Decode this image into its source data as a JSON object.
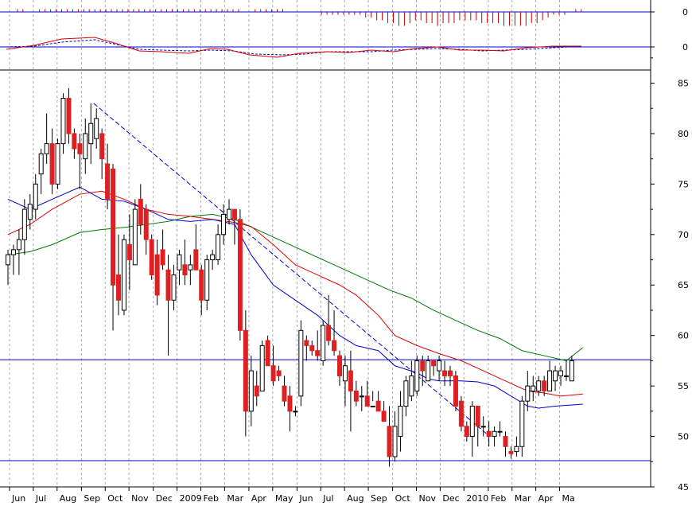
{
  "chart_data": {
    "type": "candlestick",
    "months_axis": [
      "Jun",
      "Jul",
      "Aug",
      "Sep",
      "Oct",
      "Nov",
      "Dec",
      "2009",
      "Feb",
      "Mar",
      "Apr",
      "May",
      "Jun",
      "Jul",
      "Aug",
      "Sep",
      "Oct",
      "Nov",
      "Dec",
      "2010",
      "Feb",
      "Mar",
      "Apr",
      "Ma"
    ],
    "month_positions_week": [
      0,
      4.3,
      8.6,
      13,
      17.3,
      21.6,
      26,
      30.3,
      34.6,
      38.9,
      43.3,
      47.6,
      52,
      56.3,
      60.6,
      64.9,
      69.3,
      73.6,
      77.9,
      82.2,
      86.6,
      90.9,
      95.2,
      99.5
    ],
    "price_ticks": [
      "45",
      "50",
      "55",
      "60",
      "65",
      "70",
      "75",
      "80",
      "85"
    ],
    "price_ylim": [
      45,
      86.3
    ],
    "panel2_tick": "0",
    "panel1_tick": "0",
    "horizontal_levels": [
      57.6,
      47.6
    ],
    "trendline": {
      "from": {
        "week": 15.5,
        "price": 83.0
      },
      "to": {
        "week": 86.5,
        "price": 50.3
      }
    },
    "colors": {
      "up_candle": "#ffffff",
      "down_candle": "#e02020",
      "sma_short": "#0000cc",
      "sma_mid": "#dd0000",
      "sma_long": "#007700",
      "level_line": "#0000cc",
      "osc_line": "#dd0000",
      "osc_signal": "#0000cc",
      "hist": "#cc0000"
    },
    "candles": [
      {
        "o": 67.0,
        "h": 68.5,
        "l": 65.0,
        "c": 68.0
      },
      {
        "o": 68.0,
        "h": 69.0,
        "l": 66.0,
        "c": 68.5
      },
      {
        "o": 68.5,
        "h": 70.5,
        "l": 66.0,
        "c": 69.5
      },
      {
        "o": 69.5,
        "h": 73.5,
        "l": 68.0,
        "c": 72.5
      },
      {
        "o": 71.5,
        "h": 74.0,
        "l": 70.5,
        "c": 73.0
      },
      {
        "o": 72.5,
        "h": 76.0,
        "l": 71.5,
        "c": 75.0
      },
      {
        "o": 76.0,
        "h": 78.5,
        "l": 74.0,
        "c": 78.0
      },
      {
        "o": 78.0,
        "h": 82.0,
        "l": 77.0,
        "c": 79.0
      },
      {
        "o": 79.0,
        "h": 80.5,
        "l": 74.0,
        "c": 75.0
      },
      {
        "o": 75.0,
        "h": 79.5,
        "l": 74.5,
        "c": 79.0
      },
      {
        "o": 79.0,
        "h": 84.0,
        "l": 78.0,
        "c": 83.5
      },
      {
        "o": 83.5,
        "h": 84.5,
        "l": 79.0,
        "c": 80.0
      },
      {
        "o": 80.0,
        "h": 80.5,
        "l": 77.5,
        "c": 78.5
      },
      {
        "o": 79.0,
        "h": 80.0,
        "l": 74.5,
        "c": 78.0
      },
      {
        "o": 77.5,
        "h": 81.5,
        "l": 76.0,
        "c": 80.0
      },
      {
        "o": 79.0,
        "h": 83.0,
        "l": 77.0,
        "c": 81.0
      },
      {
        "o": 79.5,
        "h": 82.5,
        "l": 78.5,
        "c": 81.5
      },
      {
        "o": 80.0,
        "h": 80.5,
        "l": 75.5,
        "c": 77.5
      },
      {
        "o": 77.0,
        "h": 79.0,
        "l": 72.5,
        "c": 73.5
      },
      {
        "o": 76.5,
        "h": 77.0,
        "l": 60.5,
        "c": 65.0
      },
      {
        "o": 66.0,
        "h": 70.0,
        "l": 62.0,
        "c": 63.5
      },
      {
        "o": 62.5,
        "h": 70.0,
        "l": 62.0,
        "c": 69.5
      },
      {
        "o": 69.0,
        "h": 72.0,
        "l": 64.5,
        "c": 67.5
      },
      {
        "o": 67.0,
        "h": 73.5,
        "l": 67.0,
        "c": 72.5
      },
      {
        "o": 73.5,
        "h": 75.0,
        "l": 70.0,
        "c": 71.0
      },
      {
        "o": 72.5,
        "h": 73.0,
        "l": 68.0,
        "c": 69.5
      },
      {
        "o": 69.5,
        "h": 70.0,
        "l": 65.5,
        "c": 66.0
      },
      {
        "o": 68.0,
        "h": 69.5,
        "l": 63.0,
        "c": 64.0
      },
      {
        "o": 68.5,
        "h": 70.5,
        "l": 66.5,
        "c": 67.0
      },
      {
        "o": 66.5,
        "h": 68.0,
        "l": 58.0,
        "c": 63.5
      },
      {
        "o": 63.5,
        "h": 67.0,
        "l": 62.5,
        "c": 66.0
      },
      {
        "o": 66.5,
        "h": 68.5,
        "l": 65.0,
        "c": 68.0
      },
      {
        "o": 67.0,
        "h": 69.5,
        "l": 65.0,
        "c": 66.0
      },
      {
        "o": 66.5,
        "h": 68.0,
        "l": 65.0,
        "c": 67.0
      },
      {
        "o": 68.5,
        "h": 71.0,
        "l": 66.5,
        "c": 66.5
      },
      {
        "o": 66.5,
        "h": 67.0,
        "l": 62.0,
        "c": 63.5
      },
      {
        "o": 63.5,
        "h": 68.0,
        "l": 62.5,
        "c": 67.5
      },
      {
        "o": 67.5,
        "h": 68.5,
        "l": 66.5,
        "c": 68.0
      },
      {
        "o": 67.5,
        "h": 71.0,
        "l": 67.0,
        "c": 70.0
      },
      {
        "o": 70.0,
        "h": 73.0,
        "l": 69.0,
        "c": 72.0
      },
      {
        "o": 71.5,
        "h": 73.5,
        "l": 71.0,
        "c": 72.5
      },
      {
        "o": 72.5,
        "h": 72.5,
        "l": 69.0,
        "c": 71.5
      },
      {
        "o": 71.5,
        "h": 72.5,
        "l": 59.5,
        "c": 60.5
      },
      {
        "o": 60.5,
        "h": 62.5,
        "l": 50.0,
        "c": 52.5
      },
      {
        "o": 52.5,
        "h": 58.0,
        "l": 51.0,
        "c": 56.5
      },
      {
        "o": 55.0,
        "h": 56.5,
        "l": 53.0,
        "c": 54.0
      },
      {
        "o": 54.5,
        "h": 59.5,
        "l": 54.5,
        "c": 59.0
      },
      {
        "o": 59.5,
        "h": 60.0,
        "l": 57.0,
        "c": 57.0
      },
      {
        "o": 57.0,
        "h": 59.0,
        "l": 55.0,
        "c": 55.5
      },
      {
        "o": 56.5,
        "h": 57.0,
        "l": 55.5,
        "c": 56.0
      },
      {
        "o": 55.0,
        "h": 56.0,
        "l": 53.0,
        "c": 53.5
      },
      {
        "o": 54.0,
        "h": 55.0,
        "l": 50.5,
        "c": 52.5
      },
      {
        "o": 52.5,
        "h": 53.0,
        "l": 52.0,
        "c": 52.5
      },
      {
        "o": 54.0,
        "h": 61.5,
        "l": 53.0,
        "c": 60.5
      },
      {
        "o": 59.5,
        "h": 60.0,
        "l": 57.5,
        "c": 59.0
      },
      {
        "o": 59.0,
        "h": 59.5,
        "l": 58.0,
        "c": 58.5
      },
      {
        "o": 58.5,
        "h": 60.5,
        "l": 57.5,
        "c": 58.0
      },
      {
        "o": 57.5,
        "h": 61.5,
        "l": 57.0,
        "c": 61.0
      },
      {
        "o": 61.0,
        "h": 64.0,
        "l": 59.0,
        "c": 59.5
      },
      {
        "o": 59.5,
        "h": 62.5,
        "l": 58.0,
        "c": 58.5
      },
      {
        "o": 58.0,
        "h": 58.5,
        "l": 55.0,
        "c": 56.0
      },
      {
        "o": 55.5,
        "h": 58.0,
        "l": 53.0,
        "c": 57.0
      },
      {
        "o": 56.5,
        "h": 58.5,
        "l": 50.5,
        "c": 54.5
      },
      {
        "o": 54.5,
        "h": 55.5,
        "l": 53.0,
        "c": 53.5
      },
      {
        "o": 54.0,
        "h": 55.0,
        "l": 52.5,
        "c": 54.0
      },
      {
        "o": 54.0,
        "h": 55.5,
        "l": 53.0,
        "c": 53.0
      },
      {
        "o": 53.0,
        "h": 54.5,
        "l": 53.5,
        "c": 53.0
      },
      {
        "o": 53.5,
        "h": 54.5,
        "l": 52.5,
        "c": 52.5
      },
      {
        "o": 52.5,
        "h": 53.5,
        "l": 51.5,
        "c": 51.5
      },
      {
        "o": 51.0,
        "h": 53.0,
        "l": 47.0,
        "c": 48.0
      },
      {
        "o": 48.0,
        "h": 52.5,
        "l": 47.5,
        "c": 51.0
      },
      {
        "o": 50.0,
        "h": 54.5,
        "l": 48.5,
        "c": 53.0
      },
      {
        "o": 53.0,
        "h": 56.0,
        "l": 52.0,
        "c": 55.5
      },
      {
        "o": 54.0,
        "h": 57.5,
        "l": 53.5,
        "c": 56.0
      },
      {
        "o": 54.5,
        "h": 58.0,
        "l": 54.0,
        "c": 57.5
      },
      {
        "o": 57.5,
        "h": 58.0,
        "l": 55.0,
        "c": 56.5
      },
      {
        "o": 55.5,
        "h": 58.0,
        "l": 55.5,
        "c": 57.5
      },
      {
        "o": 57.5,
        "h": 57.5,
        "l": 56.0,
        "c": 57.0
      },
      {
        "o": 56.5,
        "h": 58.0,
        "l": 55.5,
        "c": 57.5
      },
      {
        "o": 56.5,
        "h": 57.5,
        "l": 55.0,
        "c": 56.0
      },
      {
        "o": 56.5,
        "h": 57.0,
        "l": 55.0,
        "c": 56.0
      },
      {
        "o": 56.0,
        "h": 56.5,
        "l": 52.5,
        "c": 53.0
      },
      {
        "o": 53.5,
        "h": 54.0,
        "l": 50.5,
        "c": 51.0
      },
      {
        "o": 51.0,
        "h": 51.5,
        "l": 49.5,
        "c": 50.0
      },
      {
        "o": 50.0,
        "h": 53.5,
        "l": 48.0,
        "c": 53.0
      },
      {
        "o": 53.0,
        "h": 53.0,
        "l": 49.0,
        "c": 51.0
      },
      {
        "o": 51.0,
        "h": 52.0,
        "l": 50.0,
        "c": 51.0
      },
      {
        "o": 50.5,
        "h": 51.5,
        "l": 49.0,
        "c": 50.0
      },
      {
        "o": 50.0,
        "h": 51.0,
        "l": 49.0,
        "c": 50.5
      },
      {
        "o": 50.5,
        "h": 51.5,
        "l": 50.0,
        "c": 50.5
      },
      {
        "o": 50.0,
        "h": 50.5,
        "l": 48.0,
        "c": 49.0
      },
      {
        "o": 48.5,
        "h": 49.0,
        "l": 47.8,
        "c": 48.3
      },
      {
        "o": 48.5,
        "h": 50.0,
        "l": 48.0,
        "c": 49.0
      },
      {
        "o": 49.0,
        "h": 54.0,
        "l": 48.0,
        "c": 53.5
      },
      {
        "o": 53.5,
        "h": 56.5,
        "l": 52.5,
        "c": 55.0
      },
      {
        "o": 54.5,
        "h": 56.0,
        "l": 53.5,
        "c": 55.0
      },
      {
        "o": 54.5,
        "h": 56.0,
        "l": 54.0,
        "c": 55.5
      },
      {
        "o": 55.5,
        "h": 56.0,
        "l": 54.0,
        "c": 54.5
      },
      {
        "o": 54.5,
        "h": 57.5,
        "l": 54.5,
        "c": 56.5
      },
      {
        "o": 55.5,
        "h": 57.0,
        "l": 54.5,
        "c": 56.5
      },
      {
        "o": 56.0,
        "h": 57.0,
        "l": 55.0,
        "c": 56.5
      },
      {
        "o": 56.0,
        "h": 57.5,
        "l": 55.5,
        "c": 56.0
      },
      {
        "o": 55.5,
        "h": 58.0,
        "l": 55.5,
        "c": 57.5
      }
    ],
    "sma_short": [
      [
        0,
        73.5
      ],
      [
        4,
        72.5
      ],
      [
        8,
        73.5
      ],
      [
        13,
        74.7
      ],
      [
        17,
        73.5
      ],
      [
        21,
        73.3
      ],
      [
        25,
        72.5
      ],
      [
        29,
        71.5
      ],
      [
        33,
        71.3
      ],
      [
        37,
        71.5
      ],
      [
        41,
        71.0
      ],
      [
        44,
        68.0
      ],
      [
        48,
        65.0
      ],
      [
        52,
        63.5
      ],
      [
        56,
        62.0
      ],
      [
        60,
        60.0
      ],
      [
        63,
        59.0
      ],
      [
        67,
        58.5
      ],
      [
        70,
        57.0
      ],
      [
        74,
        56.3
      ],
      [
        76,
        55.7
      ],
      [
        78,
        55.5
      ],
      [
        82,
        55.5
      ],
      [
        85,
        55.4
      ],
      [
        88,
        55.0
      ],
      [
        91,
        54.0
      ],
      [
        94,
        53.0
      ],
      [
        96,
        52.8
      ],
      [
        99,
        53.0
      ],
      [
        104,
        53.2
      ]
    ],
    "sma_mid": [
      [
        0,
        70.0
      ],
      [
        4,
        71.0
      ],
      [
        8,
        72.5
      ],
      [
        13,
        74.0
      ],
      [
        17,
        74.3
      ],
      [
        21,
        73.5
      ],
      [
        25,
        72.5
      ],
      [
        29,
        72.0
      ],
      [
        33,
        71.8
      ],
      [
        37,
        71.5
      ],
      [
        41,
        71.2
      ],
      [
        44,
        70.8
      ],
      [
        48,
        69.0
      ],
      [
        52,
        67.0
      ],
      [
        56,
        66.0
      ],
      [
        60,
        65.0
      ],
      [
        63,
        64.0
      ],
      [
        67,
        62.0
      ],
      [
        70,
        60.0
      ],
      [
        74,
        59.0
      ],
      [
        78,
        58.2
      ],
      [
        82,
        57.5
      ],
      [
        86,
        56.5
      ],
      [
        90,
        55.5
      ],
      [
        94,
        54.5
      ],
      [
        97,
        54.3
      ],
      [
        100,
        54.0
      ],
      [
        104,
        54.2
      ]
    ],
    "sma_long": [
      [
        0,
        68.0
      ],
      [
        4,
        68.3
      ],
      [
        8,
        69.0
      ],
      [
        13,
        70.2
      ],
      [
        17,
        70.5
      ],
      [
        21,
        70.7
      ],
      [
        25,
        71.0
      ],
      [
        29,
        71.3
      ],
      [
        33,
        71.8
      ],
      [
        37,
        72.0
      ],
      [
        41,
        71.5
      ],
      [
        45,
        70.5
      ],
      [
        49,
        69.5
      ],
      [
        53,
        68.5
      ],
      [
        57,
        67.5
      ],
      [
        61,
        66.5
      ],
      [
        65,
        65.5
      ],
      [
        69,
        64.5
      ],
      [
        73,
        63.7
      ],
      [
        77,
        62.5
      ],
      [
        81,
        61.5
      ],
      [
        85,
        60.5
      ],
      [
        89,
        59.7
      ],
      [
        93,
        58.5
      ],
      [
        97,
        58.0
      ],
      [
        101,
        57.5
      ],
      [
        104,
        58.8
      ]
    ],
    "osc_panel_1": [
      0,
      0,
      -1,
      -1,
      0,
      0,
      -1,
      -1,
      -1,
      -1,
      -1,
      -1,
      -1,
      -1,
      -1,
      -1,
      -1,
      -1,
      -1,
      -1,
      -1,
      -1,
      -1,
      -1,
      -1,
      -1,
      -1,
      -1,
      -1,
      -1,
      -1,
      -1,
      -1,
      -1,
      -1,
      -1,
      -1,
      -1,
      -1,
      -1,
      -1,
      -1,
      -1,
      0,
      0,
      -1,
      -1,
      -1,
      -1,
      -1,
      -1,
      0,
      0,
      0,
      0,
      0,
      0,
      1,
      1,
      1,
      1,
      1,
      1,
      1,
      1,
      2,
      2,
      3,
      3,
      4,
      4,
      5,
      5,
      4,
      3,
      3,
      4,
      4,
      5,
      4,
      4,
      4,
      3,
      3,
      3,
      3,
      4,
      4,
      4,
      4,
      5,
      5,
      5,
      5,
      5,
      4,
      4,
      3,
      2,
      1,
      1,
      1,
      0,
      -1,
      -1
    ],
    "osc_panel_2_line": [
      [
        0,
        -0.3
      ],
      [
        5,
        0.2
      ],
      [
        10,
        1.0
      ],
      [
        16,
        1.2
      ],
      [
        20,
        0.4
      ],
      [
        24,
        -0.5
      ],
      [
        28,
        -0.6
      ],
      [
        33,
        -0.8
      ],
      [
        37,
        -0.2
      ],
      [
        40,
        -0.3
      ],
      [
        44,
        -1.0
      ],
      [
        49,
        -1.3
      ],
      [
        53,
        -0.8
      ],
      [
        58,
        -0.6
      ],
      [
        62,
        -0.7
      ],
      [
        66,
        -0.4
      ],
      [
        70,
        -0.6
      ],
      [
        74,
        -0.2
      ],
      [
        78,
        0.0
      ],
      [
        82,
        -0.4
      ],
      [
        86,
        -0.4
      ],
      [
        90,
        -0.5
      ],
      [
        94,
        -0.1
      ],
      [
        99,
        0.1
      ],
      [
        104,
        0.1
      ]
    ],
    "osc_panel_2_signal": [
      [
        0,
        0.0
      ],
      [
        5,
        0.1
      ],
      [
        10,
        0.6
      ],
      [
        16,
        0.9
      ],
      [
        20,
        0.3
      ],
      [
        24,
        -0.3
      ],
      [
        28,
        -0.4
      ],
      [
        33,
        -0.5
      ],
      [
        37,
        -0.4
      ],
      [
        41,
        -0.5
      ],
      [
        45,
        -0.9
      ],
      [
        50,
        -1.0
      ],
      [
        54,
        -0.9
      ],
      [
        58,
        -0.6
      ],
      [
        62,
        -0.6
      ],
      [
        66,
        -0.6
      ],
      [
        70,
        -0.4
      ],
      [
        74,
        -0.3
      ],
      [
        78,
        -0.2
      ],
      [
        82,
        -0.3
      ],
      [
        86,
        -0.5
      ],
      [
        90,
        -0.4
      ],
      [
        94,
        -0.3
      ],
      [
        99,
        -0.1
      ],
      [
        104,
        0.1
      ]
    ]
  }
}
